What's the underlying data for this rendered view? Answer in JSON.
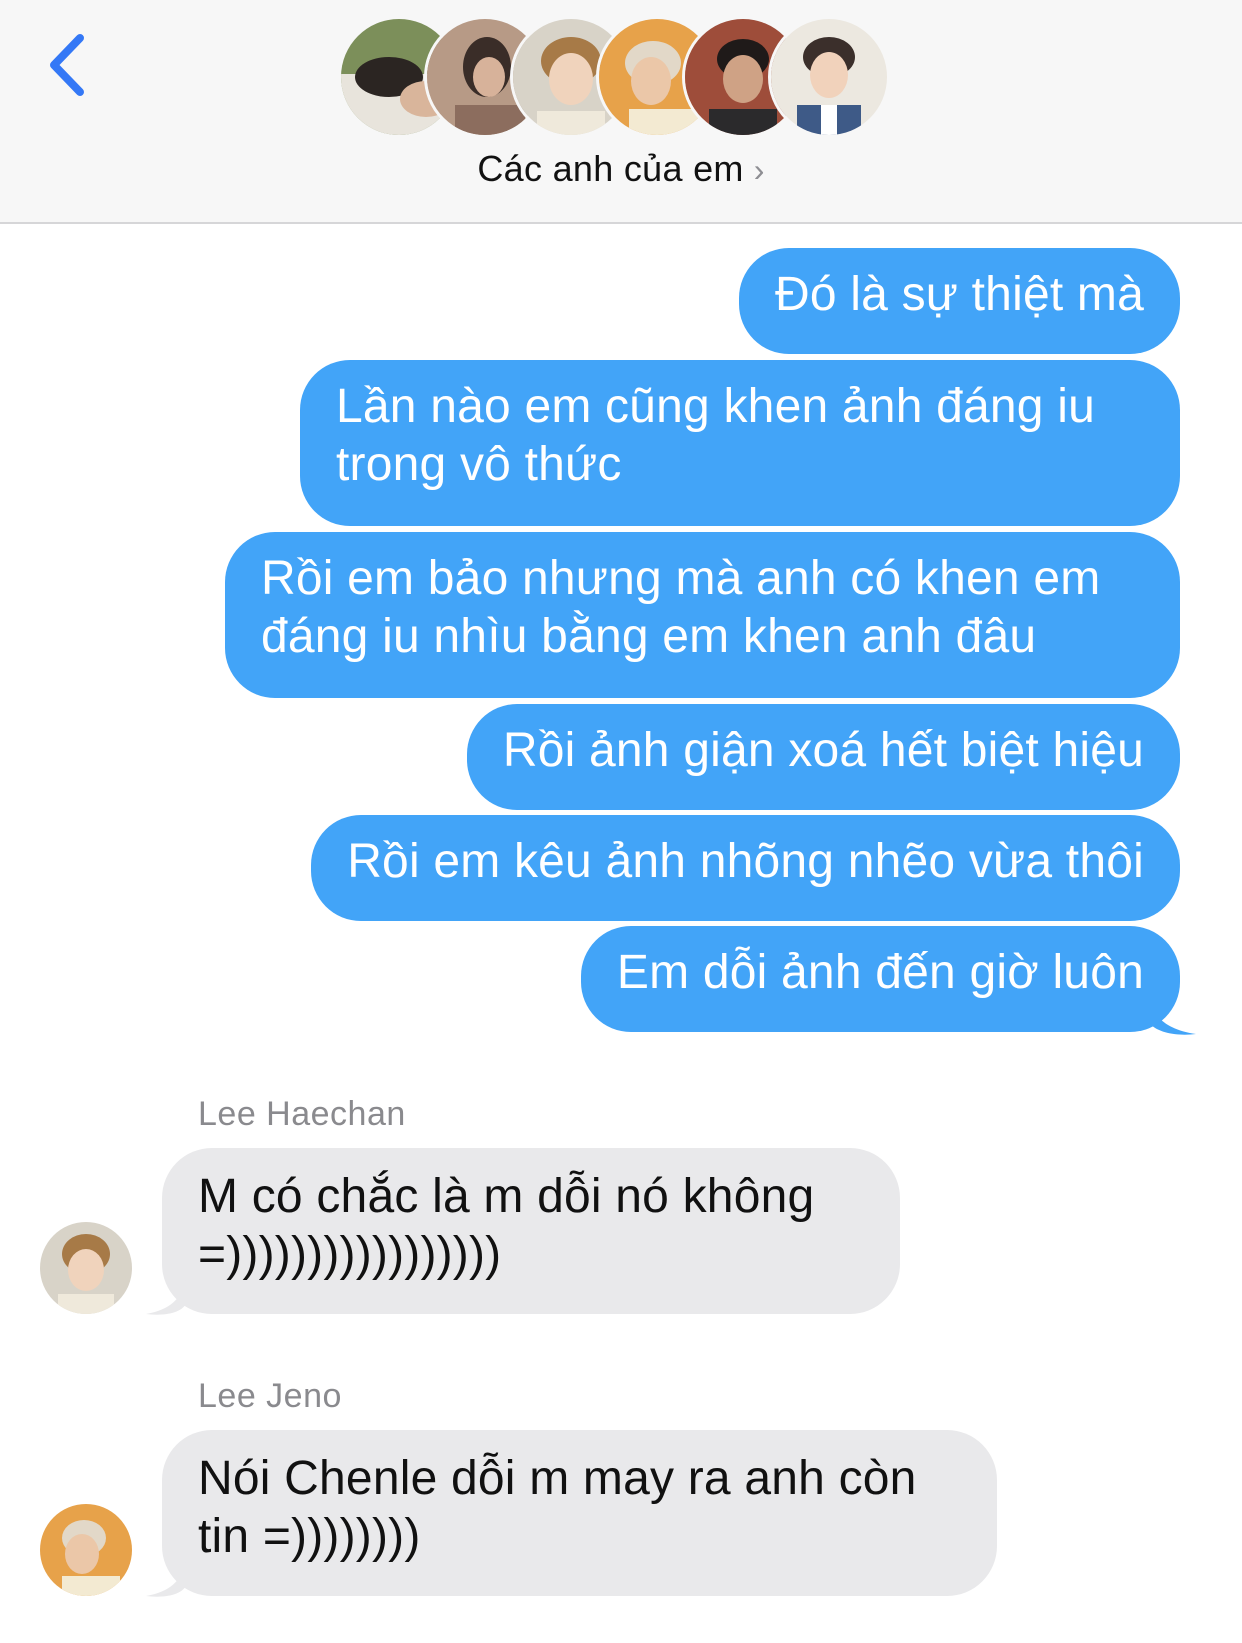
{
  "header": {
    "back_icon": "chevron-left-icon",
    "group_name": "Các anh của em",
    "chevron": "›",
    "accent_color": "#3478f6",
    "avatar_count": 6
  },
  "messages": {
    "outgoing": [
      {
        "text": "Đó là sự thiệt mà"
      },
      {
        "text": "Lần nào em cũng khen ảnh đáng iu trong vô thức"
      },
      {
        "text": "Rồi em bảo nhưng mà anh có khen em đáng iu nhìu bằng em khen anh đâu"
      },
      {
        "text": "Rồi ảnh giận xoá hết biệt hiệu"
      },
      {
        "text": "Rồi em kêu ảnh nhõng nhẽo vừa thôi"
      },
      {
        "text": "Em dỗi ảnh đến giờ luôn"
      }
    ],
    "incoming": [
      {
        "sender": "Lee Haechan",
        "text": "M có chắc là m dỗi nó không =)))))))))))))))))"
      },
      {
        "sender": "Lee Jeno",
        "text": "Nói Chenle dỗi m may ra anh còn tin =))))))))"
      }
    ]
  },
  "colors": {
    "outgoing_bubble": "#42a4f8",
    "incoming_bubble": "#e9e9eb",
    "header_bg": "#f7f7f7"
  }
}
